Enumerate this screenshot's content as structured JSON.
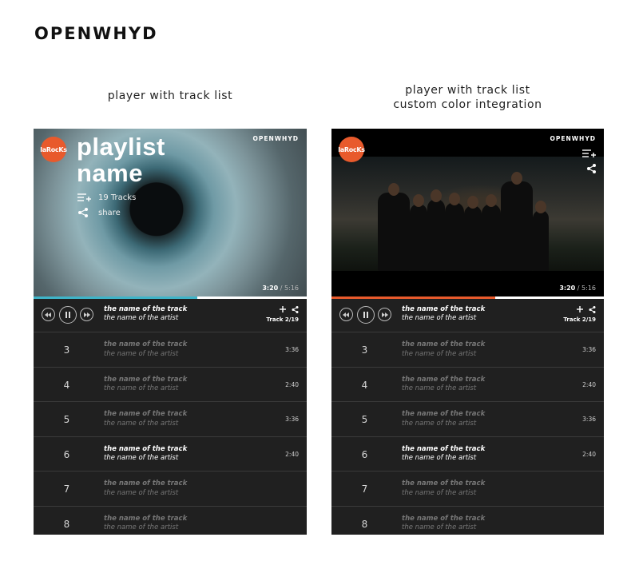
{
  "brand": "OPENWHYD",
  "captions": {
    "left": [
      "player with track list"
    ],
    "right": [
      "player with track list",
      "custom color integration"
    ]
  },
  "colors": {
    "left_accent": "#3fb4c8",
    "right_accent": "#e85a2c",
    "logo": "#e85a2c"
  },
  "logo_text": "laRocKs",
  "watermark": "OPENWHYD",
  "playlist": {
    "title_line1": "playlist",
    "title_line2": "name",
    "tracks": "19 Tracks",
    "share": "share"
  },
  "time": {
    "current": "3:20",
    "total": "/ 5:16"
  },
  "progress": 0.6,
  "now_playing": {
    "track": "the name of the track",
    "artist": "the name of the artist",
    "counter": "Track 2/19"
  },
  "icons": {
    "rewind": "rewind-icon",
    "pause": "pause-icon",
    "forward": "fast-forward-icon",
    "add": "plus-icon",
    "share": "share-icon",
    "queue": "playlist-add-icon"
  },
  "tracks": [
    {
      "num": "3",
      "track": "the name of the track",
      "artist": "the name of the artist",
      "duration": "3:36",
      "active": false
    },
    {
      "num": "4",
      "track": "the name of the track",
      "artist": "the name of the artist",
      "duration": "2:40",
      "active": false
    },
    {
      "num": "5",
      "track": "the name of the track",
      "artist": "the name of the artist",
      "duration": "3:36",
      "active": false
    },
    {
      "num": "6",
      "track": "the name of the track",
      "artist": "the name of the artist",
      "duration": "2:40",
      "active": true
    },
    {
      "num": "7",
      "track": "the name of the track",
      "artist": "the name of the artist",
      "duration": "",
      "active": false
    },
    {
      "num": "8",
      "track": "the name of the track",
      "artist": "the name of the artist",
      "duration": "",
      "active": false
    }
  ]
}
